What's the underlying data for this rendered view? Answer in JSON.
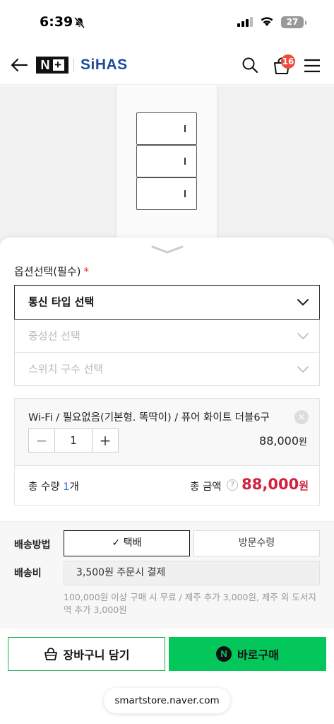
{
  "status_bar": {
    "time": "6:39",
    "battery": "27"
  },
  "header": {
    "badge_logo": "N",
    "brand": "SiHAS",
    "cart_count": "16"
  },
  "options": {
    "title": "옵션선택(필수)",
    "required_mark": "*",
    "selects": [
      {
        "label": "통신 타입 선택",
        "state": "active"
      },
      {
        "label": "중성선 선택",
        "state": "disabled"
      },
      {
        "label": "스위치 구수 선택",
        "state": "disabled"
      }
    ]
  },
  "selected_item": {
    "name": "Wi-Fi / 필요없음(기본형. 똑딱이) / 퓨어 화이트 더블6구",
    "quantity": "1",
    "price": "88,000",
    "price_unit": "원"
  },
  "totals": {
    "qty_label": "총 수량",
    "qty_value": "1",
    "qty_unit": "개",
    "amount_label": "총 금액",
    "help": "?",
    "amount": "88,000",
    "amount_unit": "원"
  },
  "delivery": {
    "method_label": "배송방법",
    "methods": [
      "택배",
      "방문수령"
    ],
    "selected_check": "✓",
    "fee_label": "배송비",
    "fee_value": "3,500원 주문시 결제",
    "fee_note": "100,000원 이상 구매 시 무료 / 제주 추가 3,000원, 제주 외 도서지역 추가 3,000원"
  },
  "actions": {
    "cart_label": "장바구니 담기",
    "buy_label": "바로구매",
    "npay_glyph": "N"
  },
  "browser": {
    "url": "smartstore.naver.com"
  },
  "colors": {
    "accent_green": "#03c75a",
    "price_red": "#d0213e",
    "qty_blue": "#3a6fd8"
  }
}
